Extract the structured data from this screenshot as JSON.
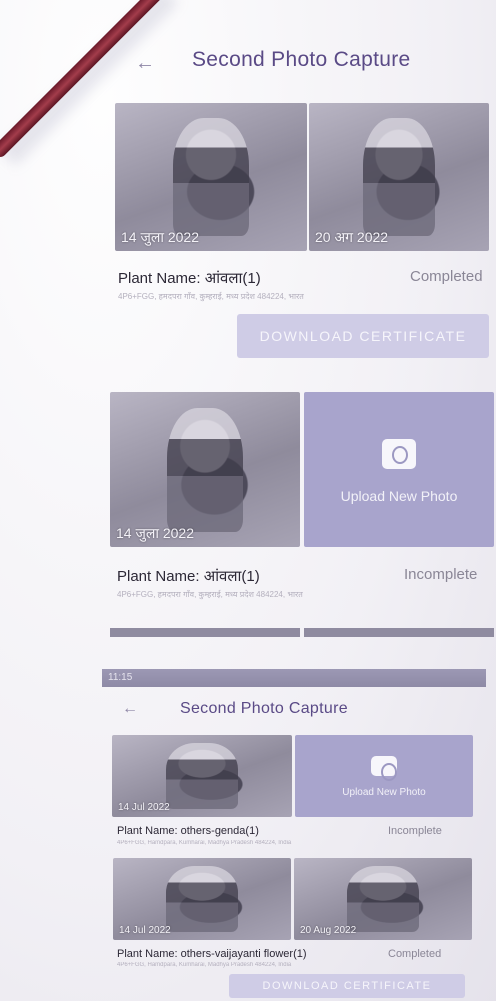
{
  "screen1": {
    "title": "Second Photo Capture",
    "cards": [
      {
        "photos": [
          {
            "date": "14 जुला 2022"
          },
          {
            "date": "20 अग 2022"
          }
        ],
        "plant_name": "Plant Name: आंवला(1)",
        "status": "Completed",
        "address": "4P6+FGG, हमदपरा गाँव, कुम्हराई, मध्य प्रदेश 484224, भारत",
        "button": "DOWNLOAD CERTIFICATE"
      },
      {
        "photos": [
          {
            "date": "14 जुला 2022"
          }
        ],
        "upload_label": "Upload New Photo",
        "plant_name": "Plant Name: आंवला(1)",
        "status": "Incomplete",
        "address": "4P6+FGG, हमदपरा गाँव, कुम्हराई, मध्य प्रदेश 484224, भारत"
      }
    ]
  },
  "screen2": {
    "status_time": "11:15",
    "title": "Second Photo Capture",
    "cards": [
      {
        "photos": [
          {
            "date": "14 Jul 2022"
          }
        ],
        "upload_label": "Upload New Photo",
        "plant_name": "Plant Name: others-genda(1)",
        "status": "Incomplete",
        "address": "4P6+FGG, Hamdpara, Kumharai, Madhya Pradesh 484224, India"
      },
      {
        "photos": [
          {
            "date": "14 Jul 2022"
          },
          {
            "date": "20 Aug 2022"
          }
        ],
        "plant_name": "Plant Name: others-vaijayanti flower(1)",
        "status": "Completed",
        "address": "4P6+FGG, Hamdpara, Kumharai, Madhya Pradesh 484224, India",
        "button": "DOWNLOAD CERTIFICATE"
      }
    ]
  }
}
